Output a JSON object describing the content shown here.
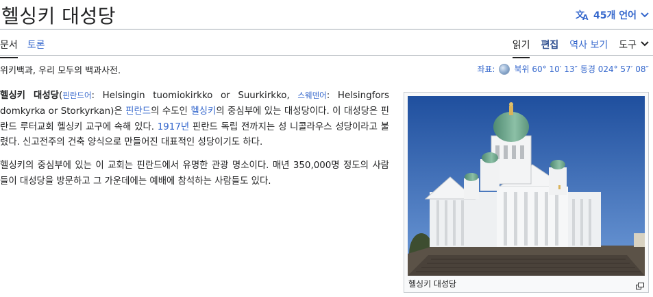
{
  "page": {
    "title": "헬싱키 대성당",
    "language_button": "45개 언어"
  },
  "tabs": {
    "left": [
      "문서",
      "토론"
    ],
    "right": {
      "read": "읽기",
      "edit": "편집",
      "history": "역사 보기",
      "tools": "도구"
    }
  },
  "tagline": "위키백과, 우리 모두의 백과사전.",
  "coordinates": {
    "label": "좌표:",
    "value": "북위 60° 10′ 13″ 동경 024° 57′ 08″"
  },
  "article": {
    "p1": {
      "subject": "헬싱키 대성당",
      "lang1": "핀란드어",
      "name1": ": Helsingin tuomiokirkko or Suurkirkko, ",
      "lang2": "스웨덴어",
      "name2": ": Helsingfors domkyrka or Storkyrkan",
      "t1": "은 ",
      "link_finland": "핀란드",
      "t2": "의 수도인 ",
      "link_helsinki": "헬싱키",
      "t3": "의 중심부에 있는 대성당이다. 이 대성당은 핀란드 루터교회 헬싱키 교구에 속해 있다. ",
      "link_1917": "1917년",
      "t4": " 핀란드 독립 전까지는 성 니콜라우스 성당이라고 불렸다. 신고전주의 건축 양식으로 만들어진 대표적인 성당이기도 하다."
    },
    "p2": "헬싱키의 중심부에 있는 이 교회는 핀란드에서 유명한 관광 명소이다. 매년 350,000명 정도의 사람 들이 대성당을 방문하고 그 가운데에는 예배에 참석하는 사람들도 있다."
  },
  "infobox": {
    "caption": "헬싱키 대성당"
  },
  "colors": {
    "link": "#3366cc",
    "text": "#202122",
    "border": "#a2a9b1"
  },
  "icons": [
    "translate-icon",
    "chevron-down-icon",
    "globe-icon",
    "enlarge-icon"
  ]
}
